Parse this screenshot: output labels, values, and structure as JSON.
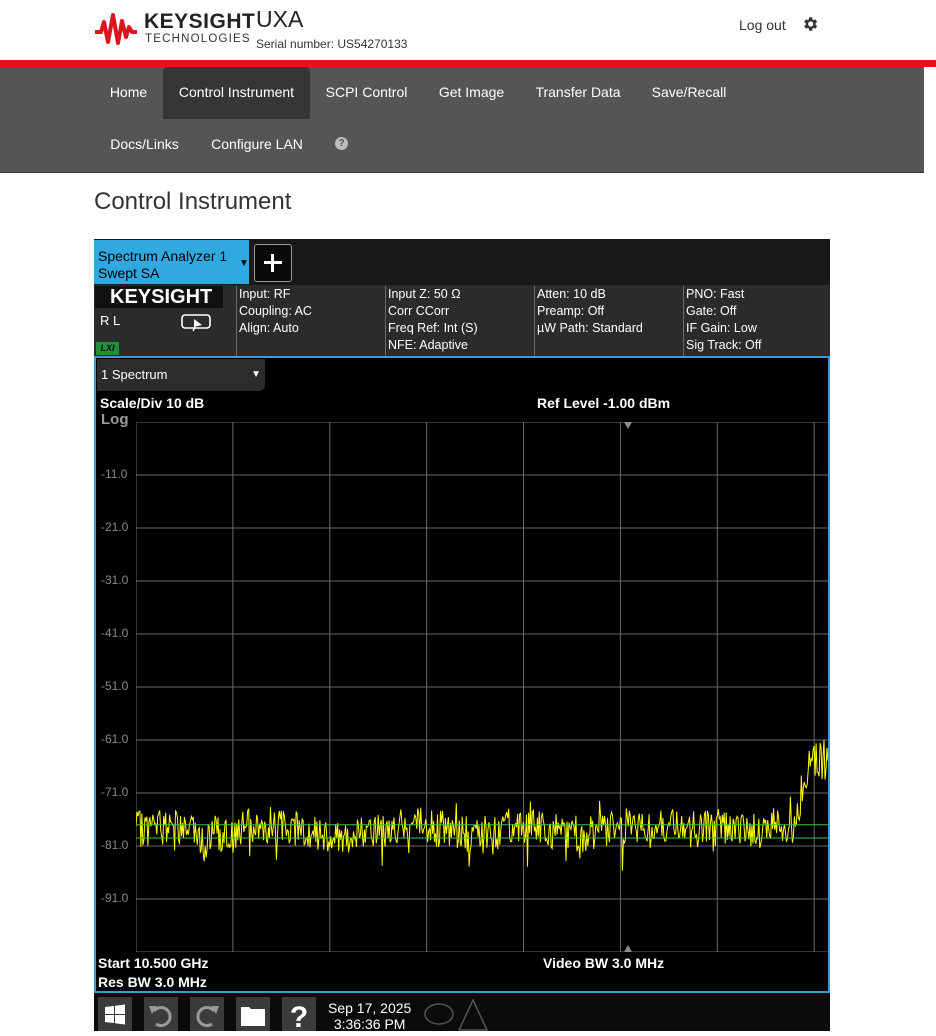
{
  "header": {
    "brand": "KEYSIGHT",
    "brand_sub": "TECHNOLOGIES",
    "instrument_name": "UXA",
    "serial": "Serial number: US54270133",
    "logout": "Log out",
    "settings_icon": "gear-icon"
  },
  "nav": {
    "items": [
      "Home",
      "Control Instrument",
      "SCPI Control",
      "Get Image",
      "Transfer Data",
      "Save/Recall",
      "Docs/Links",
      "Configure LAN"
    ],
    "active": "Control Instrument",
    "help_icon": "question-circle-icon"
  },
  "page_title": "Control Instrument",
  "instrument": {
    "tab_line1": "Spectrum Analyzer 1",
    "tab_line2": "Swept SA",
    "tab_arrow": "▼",
    "add_icon": "plus-icon",
    "brand": "KEYSIGHT",
    "rl": "R L",
    "lxi": "LXI",
    "local_icon": "local-return-icon",
    "info_cols": [
      [
        "Input: RF",
        "Coupling: AC",
        "Align: Auto"
      ],
      [
        "Input Z: 50 Ω",
        "Corr CCorr",
        "Freq Ref: Int (S)",
        "NFE: Adaptive"
      ],
      [
        "Atten: 10 dB",
        "Preamp: Off",
        "µW Path: Standard"
      ],
      [
        "PNO: Fast",
        "Gate: Off",
        "IF Gain: Low",
        "Sig Track: Off"
      ]
    ],
    "trace_dropdown": "1 Spectrum",
    "trace_arrow": "▼",
    "scale_div": "Scale/Div 10 dB",
    "ref_level": "Ref Level -1.00 dBm",
    "log_label": "Log",
    "start": "Start 10.500 GHz",
    "res_bw": "Res BW 3.0 MHz",
    "video_bw": "Video BW 3.0 MHz",
    "date_line1": "Sep 17, 2025",
    "date_line2": "3:36:36 PM",
    "taskbar_icons": [
      "windows-icon",
      "undo-icon",
      "redo-icon",
      "folder-icon",
      "help-icon",
      "message-icon",
      "warning-icon"
    ]
  },
  "chart_data": {
    "type": "line",
    "y_tick_labels": [
      "-11.0",
      "-21.0",
      "-31.0",
      "-41.0",
      "-51.0",
      "-61.0",
      "-71.0",
      "-81.0",
      "-91.0"
    ],
    "ylim": [
      -101,
      -1
    ],
    "xlim": [
      0,
      100
    ],
    "grid": true,
    "series": [
      {
        "color": "#ffff00",
        "x": [
          0,
          5,
          10,
          15,
          20,
          25,
          30,
          35,
          40,
          45,
          50,
          55,
          60,
          65,
          68,
          70,
          72,
          75,
          80,
          85,
          90,
          93,
          95,
          96,
          97,
          98,
          99,
          100
        ],
        "y": [
          -78,
          -77,
          -79,
          -78,
          -77,
          -78,
          -79,
          -78,
          -77,
          -78,
          -79,
          -77,
          -78,
          -79,
          -78,
          -77,
          -78,
          -77,
          -78,
          -77,
          -78,
          -77,
          -78,
          -72,
          -66,
          -65,
          -65,
          -66
        ]
      },
      {
        "color": "#3fbf3f",
        "x": [
          0,
          100
        ],
        "y": [
          -77,
          -77
        ]
      },
      {
        "color": "#3fbf3f",
        "x": [
          0,
          100
        ],
        "y": [
          -79.5,
          -79.5
        ]
      }
    ]
  }
}
